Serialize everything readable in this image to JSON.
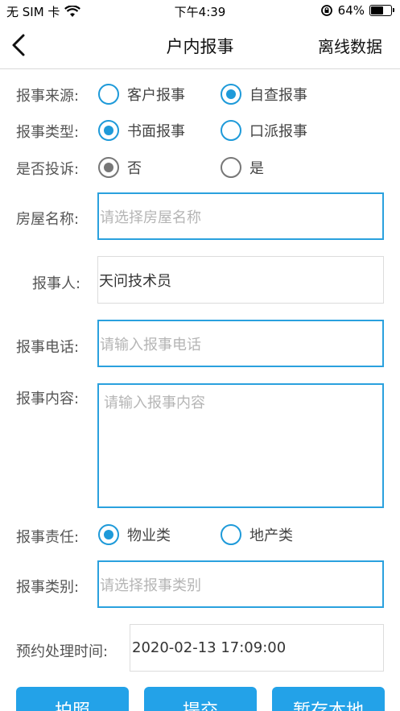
{
  "status": {
    "carrier": "无 SIM 卡",
    "time": "下午4:39",
    "battery": "64%",
    "battery_level": 0.64
  },
  "nav": {
    "title": "户内报事",
    "right": "离线数据"
  },
  "source": {
    "label": "报事来源:",
    "options": [
      "客户报事",
      "自查报事"
    ],
    "selected": 1
  },
  "type": {
    "label": "报事类型:",
    "options": [
      "书面报事",
      "口派报事"
    ],
    "selected": 0
  },
  "complaint": {
    "label": "是否投诉:",
    "options": [
      "否",
      "是"
    ],
    "selected": 0
  },
  "house": {
    "label": "房屋名称:",
    "placeholder": "请选择房屋名称"
  },
  "reporter": {
    "label": "报事人:",
    "value": "天问技术员"
  },
  "phone": {
    "label": "报事电话:",
    "placeholder": "请输入报事电话"
  },
  "content": {
    "label": "报事内容:",
    "placeholder": "请输入报事内容"
  },
  "responsibility": {
    "label": "报事责任:",
    "options": [
      "物业类",
      "地产类"
    ],
    "selected": 0
  },
  "category": {
    "label": "报事类别:",
    "placeholder": "请选择报事类别"
  },
  "appointment": {
    "label": "预约处理时间:",
    "value": "2020-02-13 17:09:00"
  },
  "buttons": {
    "photo": "拍照",
    "submit": "提交",
    "save": "暂存本地"
  }
}
